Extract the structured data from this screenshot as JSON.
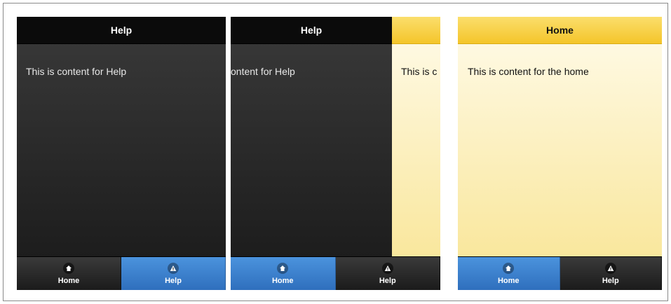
{
  "screens": [
    {
      "header_title": "Help",
      "content_text": "This is content for Help",
      "tabs": [
        {
          "label": "Home",
          "icon": "home-icon",
          "active": false
        },
        {
          "label": "Help",
          "icon": "alert-icon",
          "active": true
        }
      ]
    },
    {
      "header_title": "Help",
      "content_text_dark": "ontent for Help",
      "content_text_light": "This is c",
      "tabs": [
        {
          "label": "Home",
          "icon": "home-icon",
          "active": true
        },
        {
          "label": "Help",
          "icon": "alert-icon",
          "active": false
        }
      ]
    },
    {
      "header_title": "Home",
      "content_text": "This is content for the home",
      "tabs": [
        {
          "label": "Home",
          "icon": "home-icon",
          "active": true
        },
        {
          "label": "Help",
          "icon": "alert-icon",
          "active": false
        }
      ]
    }
  ],
  "colors": {
    "dark_header": "#0b0b0b",
    "dark_body_top": "#3a3a3a",
    "dark_body_bottom": "#1d1d1d",
    "light_header": "#f4c52a",
    "light_body_top": "#fffbea",
    "light_body_bottom": "#f9e79d",
    "active_tab": "#3b82cf"
  }
}
